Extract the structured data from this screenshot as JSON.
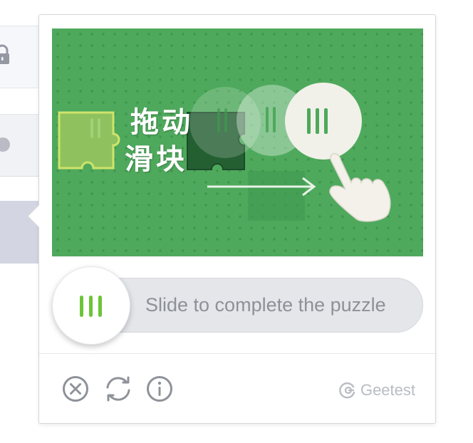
{
  "captcha": {
    "hint_line1": "拖动",
    "hint_line2": "滑块",
    "slider_tip": "Slide to complete the puzzle",
    "brand": "Geetest",
    "colors": {
      "image_green": "#4ea95c",
      "knob_bar_green": "#6cc437",
      "track_gray": "#e4e6ea",
      "tip_text": "#8d9197",
      "icon_gray": "#8e9299",
      "brand_gray": "#b8bcc2"
    }
  },
  "footer": {
    "icons": [
      "close-icon",
      "refresh-icon",
      "info-icon"
    ],
    "brand_icon": "geetest-logo-icon"
  },
  "background": {
    "icons": [
      "lock-icon"
    ]
  }
}
